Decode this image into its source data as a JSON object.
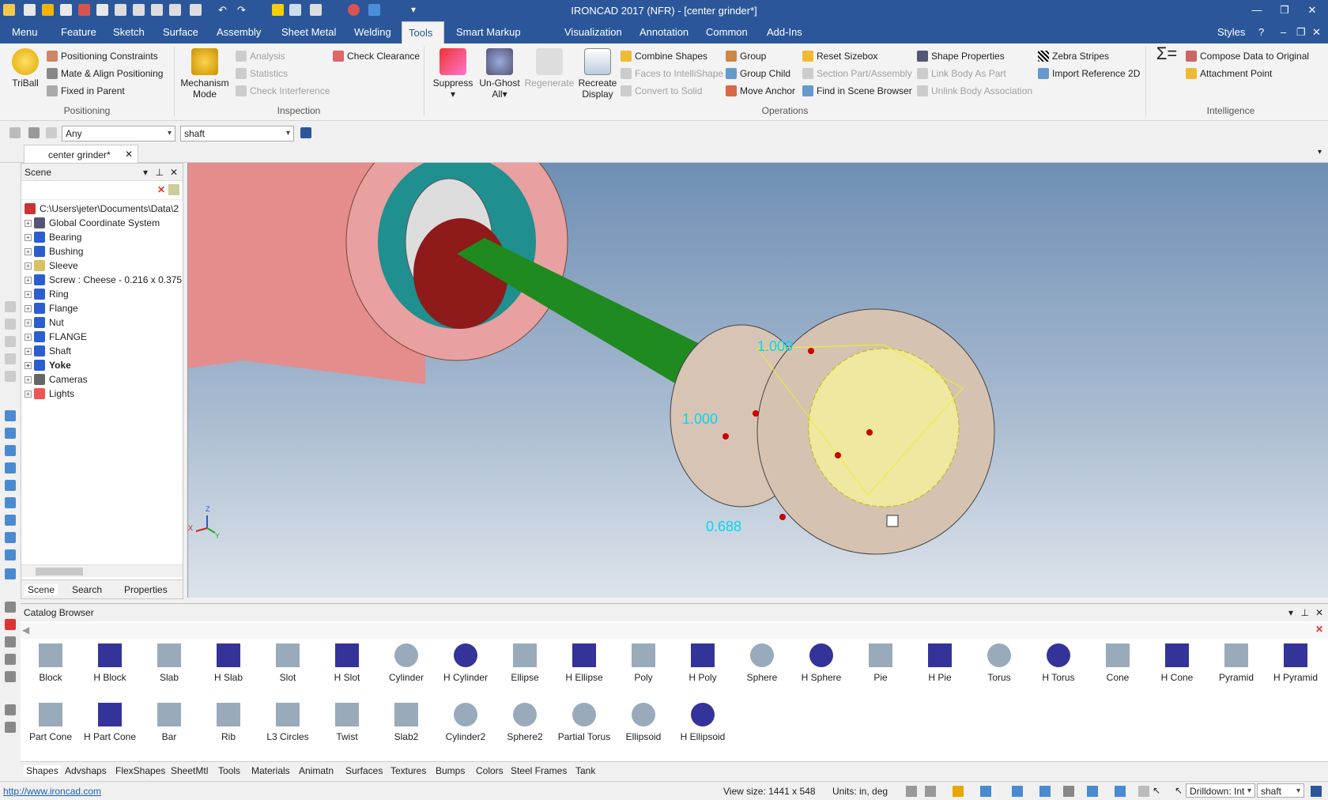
{
  "window": {
    "title": "IRONCAD 2017 (NFR) - [center grinder*]"
  },
  "menu_tabs": [
    "Menu",
    "Feature",
    "Sketch",
    "Surface",
    "Assembly",
    "Sheet Metal",
    "Welding",
    "Tools",
    "Smart Markup",
    "Visualization",
    "Annotation",
    "Common",
    "Add-Ins"
  ],
  "styles_label": "Styles",
  "ribbon": {
    "triball": "TriBall",
    "positioning_constraints": "Positioning Constraints",
    "mate_align": "Mate & Align Positioning",
    "fixed_in_parent": "Fixed in Parent",
    "group_positioning": "Positioning",
    "mechanism_mode": [
      "Mechanism",
      "Mode"
    ],
    "analysis": "Analysis",
    "statistics": "Statistics",
    "check_interference": "Check Interference",
    "check_clearance": "Check Clearance",
    "group_inspection": "Inspection",
    "suppress": "Suppress",
    "unghost": [
      "Un-Ghost",
      "All"
    ],
    "regenerate": "Regenerate",
    "recreate": [
      "Recreate",
      "Display"
    ],
    "combine_shapes": "Combine Shapes",
    "faces_intellishape": "Faces to IntelliShape",
    "convert_solid": "Convert to Solid",
    "group": "Group",
    "group_child": "Group Child",
    "move_anchor": "Move Anchor",
    "reset_sizebox": "Reset Sizebox",
    "section_part": "Section Part/Assembly",
    "find_scene": "Find in Scene Browser",
    "shape_props": "Shape Properties",
    "link_body": "Link Body As Part",
    "unlink_body": "Unlink Body Association",
    "zebra": "Zebra Stripes",
    "import_ref": "Import Reference 2D",
    "group_operations": "Operations",
    "compose": "Compose Data to Original",
    "attach_point": "Attachment Point",
    "group_intelligence": "Intelligence"
  },
  "selection": {
    "filter": "Any",
    "name": "shaft"
  },
  "doc_tab": "center grinder*",
  "scene": {
    "title": "Scene",
    "root": "C:\\Users\\jeter\\Documents\\Data\\2",
    "items": [
      "Global Coordinate System",
      "Bearing",
      "Bushing",
      "Sleeve",
      "Screw : Cheese - 0.216 x 0.375",
      "Ring",
      "Flange",
      "Nut",
      "FLANGE",
      "Shaft",
      "Yoke",
      "Cameras",
      "Lights"
    ],
    "tabs": [
      "Scene",
      "Search",
      "Properties"
    ]
  },
  "viewport": {
    "dim_top": "1.000",
    "dim_left": "1.000",
    "dim_bottom": "0.688",
    "axes": {
      "z": "Z",
      "x": "X",
      "y": "Y"
    }
  },
  "catalog": {
    "title": "Catalog Browser",
    "row1": [
      "Block",
      "H Block",
      "Slab",
      "H Slab",
      "Slot",
      "H Slot",
      "Cylinder",
      "H Cylinder",
      "Ellipse",
      "H Ellipse",
      "Poly",
      "H Poly",
      "Sphere",
      "H Sphere",
      "Pie",
      "H Pie",
      "Torus",
      "H Torus",
      "Cone",
      "H Cone",
      "Pyramid",
      "H Pyramid"
    ],
    "row2": [
      "Part Cone",
      "H Part Cone",
      "Bar",
      "Rib",
      "L3 Circles",
      "Twist",
      "Slab2",
      "Cylinder2",
      "Sphere2",
      "Partial Torus",
      "Ellipsoid",
      "H Ellipsoid"
    ],
    "tabs": [
      "Shapes",
      "Advshaps",
      "FlexShapes",
      "SheetMtl",
      "Tools",
      "Materials",
      "Animatn",
      "Surfaces",
      "Textures",
      "Bumps",
      "Colors",
      "Steel Frames",
      "Tank"
    ]
  },
  "status": {
    "url": "http://www.ironcad.com",
    "view_size": "View size: 1441 x  548",
    "units": "Units: in, deg",
    "drilldown": "Drilldown: Int",
    "name": "shaft"
  },
  "colors": {
    "accent": "#2b579a",
    "shaft": "#1f8a1f",
    "body": "#e28a8a"
  }
}
